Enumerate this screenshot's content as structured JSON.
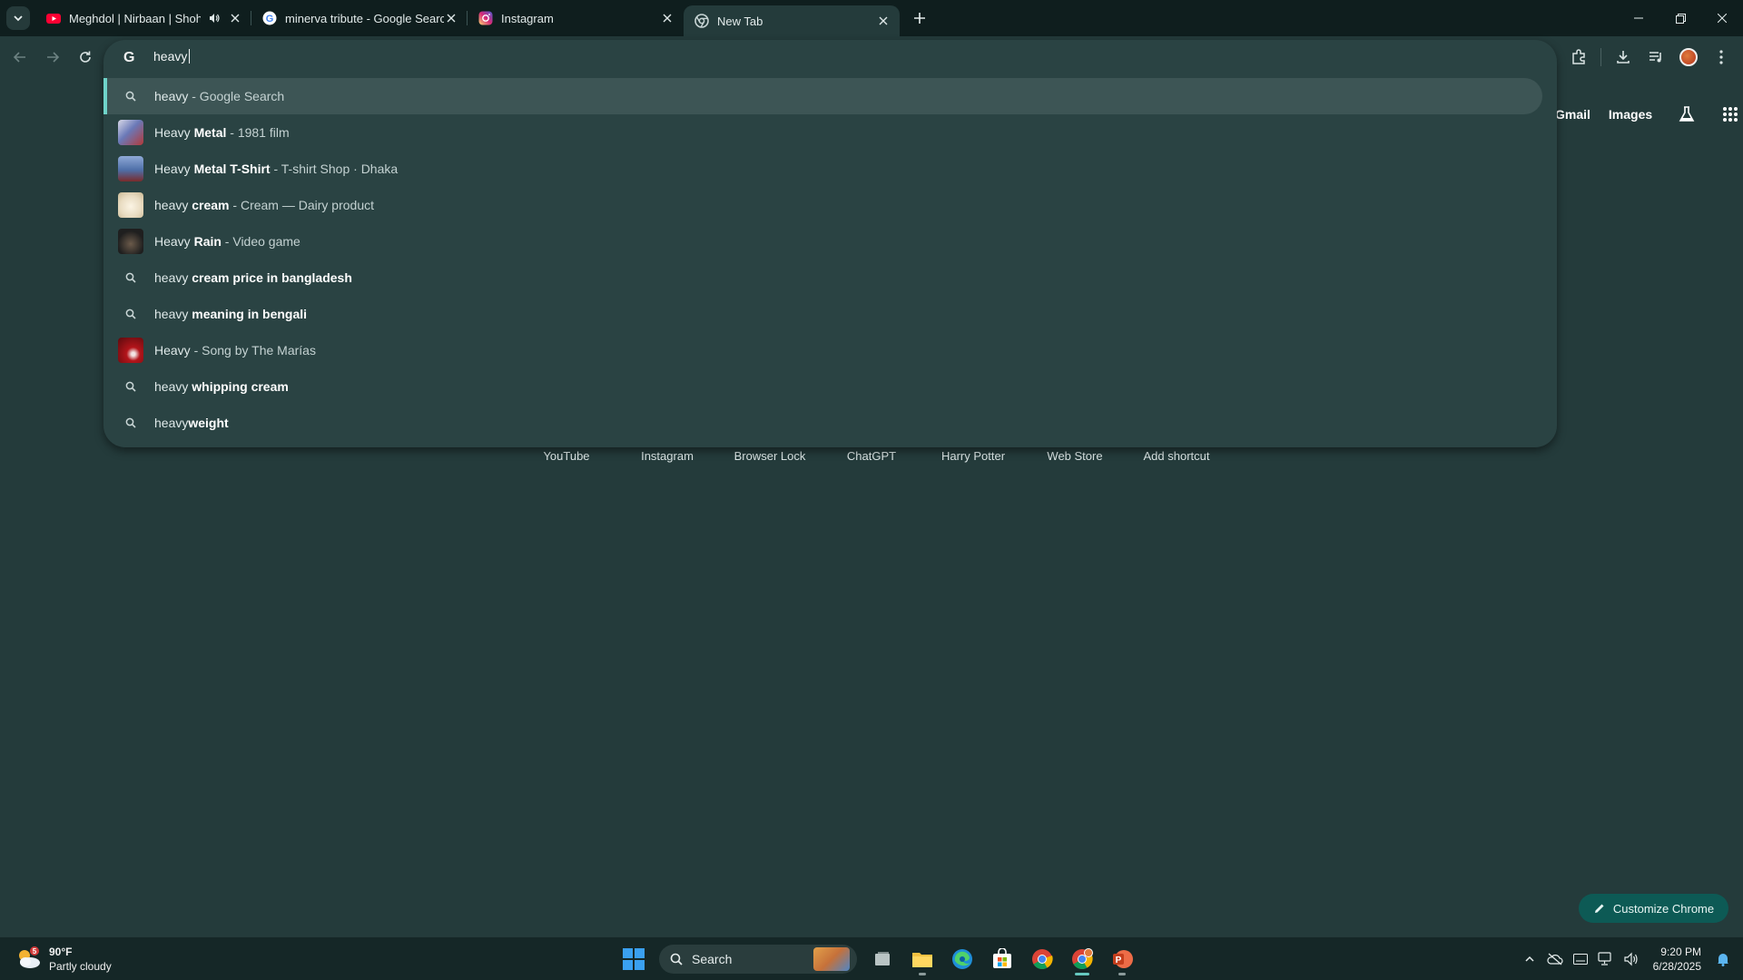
{
  "tabs": [
    {
      "title": "Meghdol | Nirbaan | Shohor",
      "favicon": "youtube-icon",
      "audio": true
    },
    {
      "title": "minerva tribute - Google Search",
      "favicon": "google-icon"
    },
    {
      "title": "Instagram",
      "favicon": "instagram-icon"
    },
    {
      "title": "New Tab",
      "favicon": "chrome-icon",
      "active": true
    }
  ],
  "omnibox": {
    "text": "heavy",
    "search_engine_icon": "google-g-icon"
  },
  "suggestions": [
    {
      "icon": "search-icon",
      "query": "heavy",
      "bold": "",
      "desc": " - Google Search",
      "selected": true
    },
    {
      "icon": "thumbnail",
      "query": "Heavy ",
      "bold": "Metal",
      "desc": " - 1981 film",
      "thumb_color": "#6a79b8"
    },
    {
      "icon": "thumbnail",
      "query": "Heavy ",
      "bold": "Metal T-Shirt",
      "desc": " - T-shirt Shop · Dhaka",
      "thumb_color": "#4e6fa8"
    },
    {
      "icon": "thumbnail",
      "query": "heavy ",
      "bold": "cream",
      "desc": " - Cream — Dairy product",
      "thumb_color": "#e9dcc2"
    },
    {
      "icon": "thumbnail",
      "query": "Heavy ",
      "bold": "Rain",
      "desc": " - Video game",
      "thumb_color": "#1f1f1f"
    },
    {
      "icon": "search-icon",
      "query": "heavy ",
      "bold": "cream price in bangladesh",
      "desc": ""
    },
    {
      "icon": "search-icon",
      "query": "heavy ",
      "bold": "meaning in bengali",
      "desc": ""
    },
    {
      "icon": "thumbnail",
      "query": "Heavy",
      "bold": "",
      "desc": " - Song by The Marías",
      "thumb_color": "#b3141a"
    },
    {
      "icon": "search-icon",
      "query": "heavy ",
      "bold": "whipping cream",
      "desc": ""
    },
    {
      "icon": "search-icon",
      "query": "heavy",
      "bold": "weight",
      "desc": ""
    }
  ],
  "ntp_header": {
    "gmail": "Gmail",
    "images": "Images"
  },
  "shortcuts": [
    "YouTube",
    "Instagram",
    "Browser Lock",
    "ChatGPT",
    "Harry Potter",
    "Web Store",
    "Add shortcut"
  ],
  "customize_label": "Customize Chrome",
  "taskbar": {
    "weather_temp": "90°F",
    "weather_desc": "Partly cloudy",
    "weather_badge": "5",
    "search_label": "Search",
    "time": "9:20 PM",
    "date": "6/28/2025"
  },
  "colors": {
    "accent": "#6fd3c9",
    "background": "#243b3b",
    "omnibox": "#2a4343"
  }
}
